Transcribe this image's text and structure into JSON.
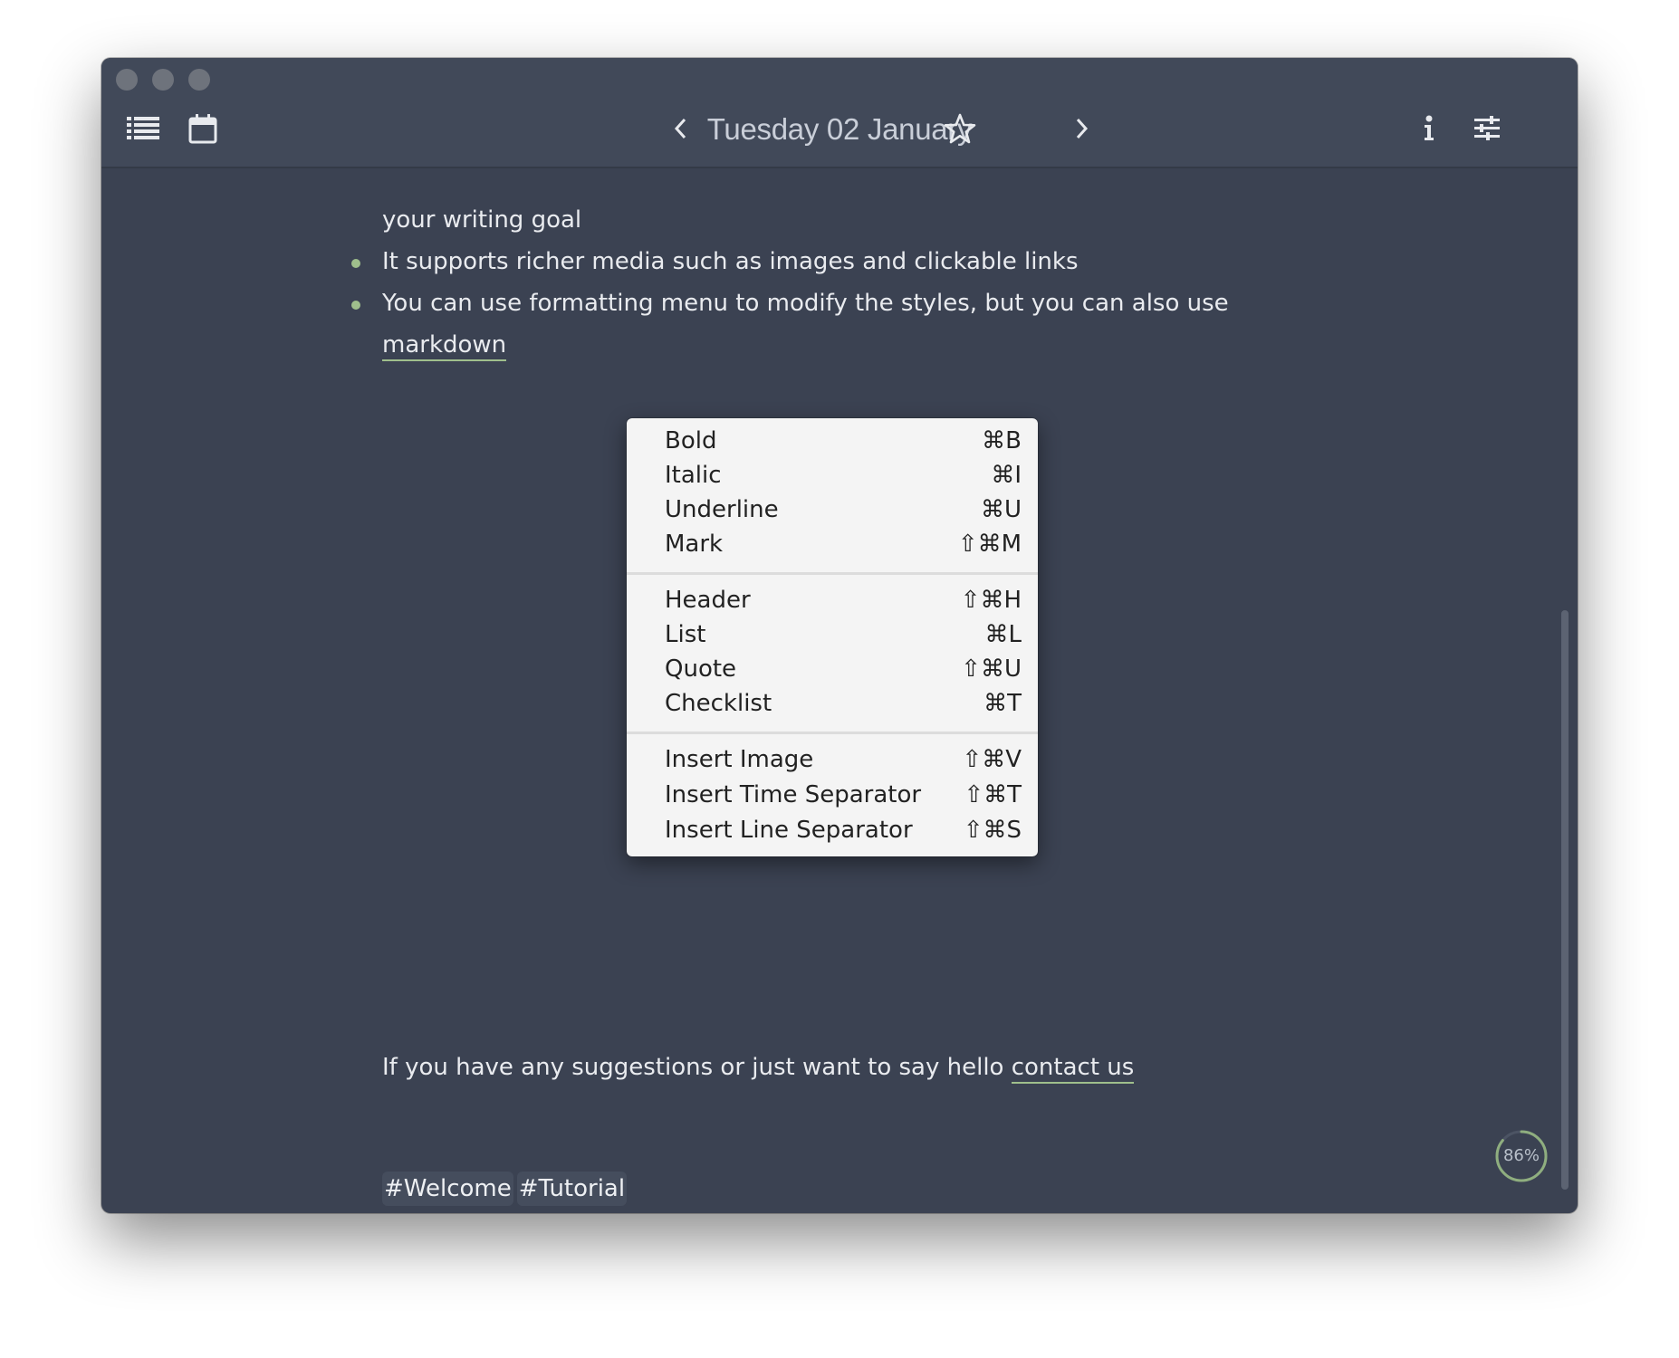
{
  "window": {
    "traffic_lights": [
      "close",
      "minimize",
      "zoom"
    ]
  },
  "toolbar": {
    "list_icon": "list-icon",
    "calendar_icon": "calendar-icon",
    "prev_icon": "chevron-left-icon",
    "date": "Tuesday 02 January",
    "star_icon": "star-icon",
    "next_icon": "chevron-right-icon",
    "info_icon": "info-icon",
    "settings_icon": "sliders-icon"
  },
  "content": {
    "line_continuation": "your writing goal",
    "bullets": [
      "It supports richer media such as images and clickable links",
      "You can use formatting menu to modify the styles, but you can also use"
    ],
    "bullet_continuation_link": "markdown",
    "suggestion_text": "If you have any suggestions or just want to say hello ",
    "contact_link": "contact us",
    "tags": [
      "#Welcome",
      "#Tutorial"
    ],
    "accent_color": "#9fbf8c"
  },
  "format_menu": {
    "groups": [
      [
        {
          "label": "Bold",
          "shortcut": "⌘B"
        },
        {
          "label": "Italic",
          "shortcut": "⌘I"
        },
        {
          "label": "Underline",
          "shortcut": "⌘U"
        },
        {
          "label": "Mark",
          "shortcut": "⇧⌘M"
        }
      ],
      [
        {
          "label": "Header",
          "shortcut": "⇧⌘H"
        },
        {
          "label": "List",
          "shortcut": "⌘L"
        },
        {
          "label": "Quote",
          "shortcut": "⇧⌘U"
        },
        {
          "label": "Checklist",
          "shortcut": "⌘T"
        }
      ],
      [
        {
          "label": "Insert Image",
          "shortcut": "⇧⌘V"
        },
        {
          "label": "Insert Time Separator",
          "shortcut": "⇧⌘T"
        },
        {
          "label": "Insert Line Separator",
          "shortcut": "⇧⌘S"
        }
      ]
    ]
  },
  "writing_goal": {
    "percent": 86,
    "label": "86%"
  }
}
